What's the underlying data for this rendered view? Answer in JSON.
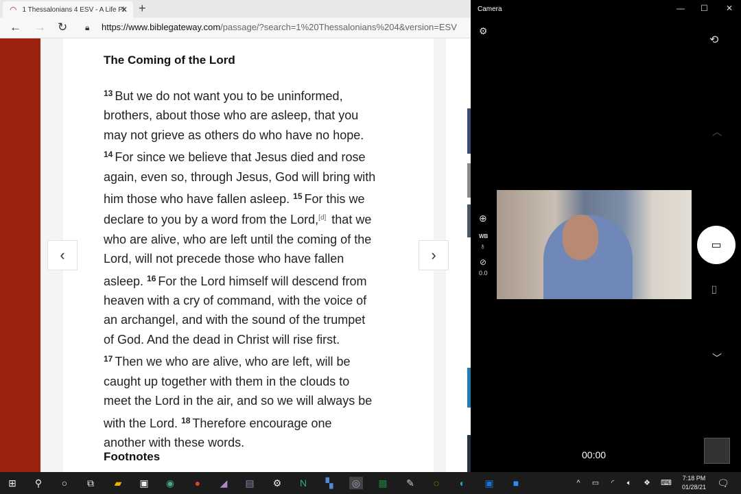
{
  "browser": {
    "tab_title": "1 Thessalonians 4 ESV - A Life Pl",
    "url_domain": "https://www.biblegateway.com",
    "url_path": "/passage/?search=1%20Thessalonians%204&version=ESV"
  },
  "passage": {
    "heading": "The Coming of the Lord",
    "lines": [
      [
        {
          "v": "13"
        },
        {
          "t": "But we do not want you to be uninformed,"
        }
      ],
      [
        {
          "t": "brothers, about those who are asleep, that you"
        }
      ],
      [
        {
          "t": "may not grieve as others do who have no hope."
        }
      ],
      [
        {
          "v": "14"
        },
        {
          "t": "For since we believe that Jesus died and rose"
        }
      ],
      [
        {
          "t": "again, even so, through Jesus, God will bring with"
        }
      ],
      [
        {
          "t": "him those who have fallen asleep. "
        },
        {
          "v": "15"
        },
        {
          "t": "For this we"
        }
      ],
      [
        {
          "t": "declare to you by a word from the Lord,"
        },
        {
          "f": "[d]"
        },
        {
          "t": " that we"
        }
      ],
      [
        {
          "t": "who are alive, who are left until the coming of the"
        }
      ],
      [
        {
          "t": "Lord, will not precede those who have fallen"
        }
      ],
      [
        {
          "t": "asleep. "
        },
        {
          "v": "16"
        },
        {
          "t": "For the Lord himself will descend from"
        }
      ],
      [
        {
          "t": "heaven with a cry of command, with the voice of"
        }
      ],
      [
        {
          "t": "an archangel, and with the sound of the trumpet"
        }
      ],
      [
        {
          "t": "of God. And the dead in Christ will rise first."
        }
      ],
      [
        {
          "v": "17"
        },
        {
          "t": "Then we who are alive, who are left, will be"
        }
      ],
      [
        {
          "t": "caught up together with them in the clouds to"
        }
      ],
      [
        {
          "t": "meet the Lord in the air, and so we will always be"
        }
      ],
      [
        {
          "t": "with the Lord. "
        },
        {
          "v": "18"
        },
        {
          "t": "Therefore encourage one"
        }
      ],
      [
        {
          "t": "another with these words."
        }
      ]
    ],
    "footnotes_heading": "Footnotes"
  },
  "camera": {
    "title": "Camera",
    "wb_label": "WB",
    "exposure_value": "0.0",
    "timer": "00:00"
  },
  "taskbar": {
    "time": "7:18 PM",
    "date": "01/28/21"
  }
}
